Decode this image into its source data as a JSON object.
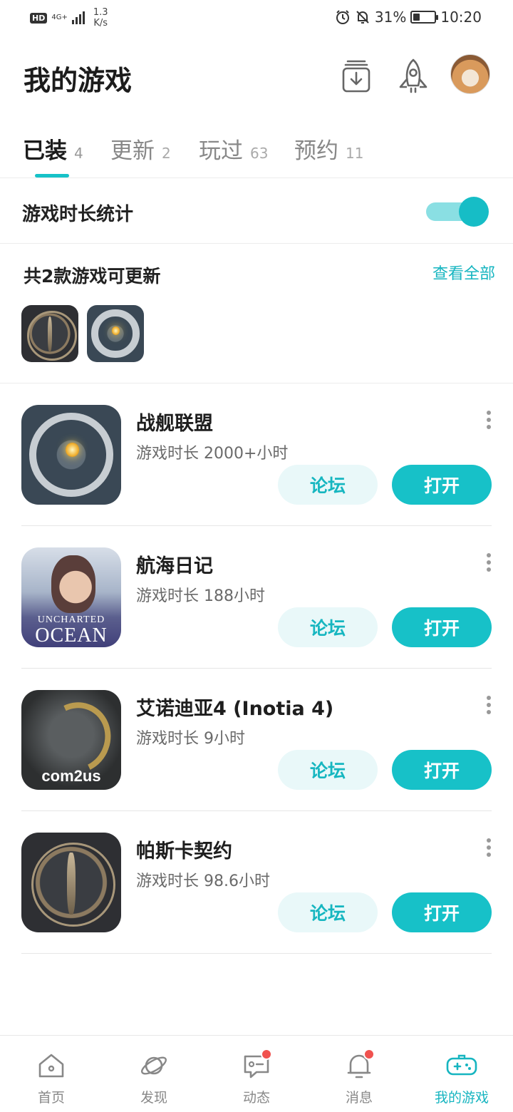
{
  "status_bar": {
    "hd": "HD",
    "network": "4G+",
    "speed_value": "1.3",
    "speed_unit": "K/s",
    "battery": "31%",
    "battery_level": 0.31,
    "time": "10:20"
  },
  "header": {
    "title": "我的游戏",
    "icons": [
      "download-icon",
      "rocket-icon",
      "avatar"
    ]
  },
  "tabs": [
    {
      "label": "已装",
      "count": "4",
      "active": true
    },
    {
      "label": "更新",
      "count": "2",
      "active": false
    },
    {
      "label": "玩过",
      "count": "63",
      "active": false
    },
    {
      "label": "预约",
      "count": "11",
      "active": false
    }
  ],
  "stats": {
    "label": "游戏时长统计",
    "enabled": true
  },
  "updates": {
    "title": "共2款游戏可更新",
    "view_all": "查看全部"
  },
  "games": [
    {
      "name": "战舰联盟",
      "time": "游戏时长 2000+小时",
      "forum": "论坛",
      "open": "打开",
      "icon": "fleet"
    },
    {
      "name": "航海日记",
      "time": "游戏时长 188小时",
      "forum": "论坛",
      "open": "打开",
      "icon": "ocean",
      "icon_text": [
        "UNCHARTED",
        "OCEAN"
      ]
    },
    {
      "name": "艾诺迪亚4 (Inotia 4)",
      "time": "游戏时长 9小时",
      "forum": "论坛",
      "open": "打开",
      "icon": "inotia",
      "icon_text": [
        "com2us"
      ]
    },
    {
      "name": "帕斯卡契约",
      "time": "游戏时长 98.6小时",
      "forum": "论坛",
      "open": "打开",
      "icon": "pascal"
    }
  ],
  "bottom_nav": [
    {
      "label": "首页",
      "icon": "home-icon",
      "badge": false,
      "active": false
    },
    {
      "label": "发现",
      "icon": "planet-icon",
      "badge": false,
      "active": false
    },
    {
      "label": "动态",
      "icon": "chat-icon",
      "badge": true,
      "active": false
    },
    {
      "label": "消息",
      "icon": "bell-icon",
      "badge": true,
      "active": false
    },
    {
      "label": "我的游戏",
      "icon": "gamepad-icon",
      "badge": false,
      "active": true
    }
  ],
  "colors": {
    "accent": "#16c2c8",
    "accent_light": "#e9f8f9",
    "badge": "#f0524f"
  }
}
